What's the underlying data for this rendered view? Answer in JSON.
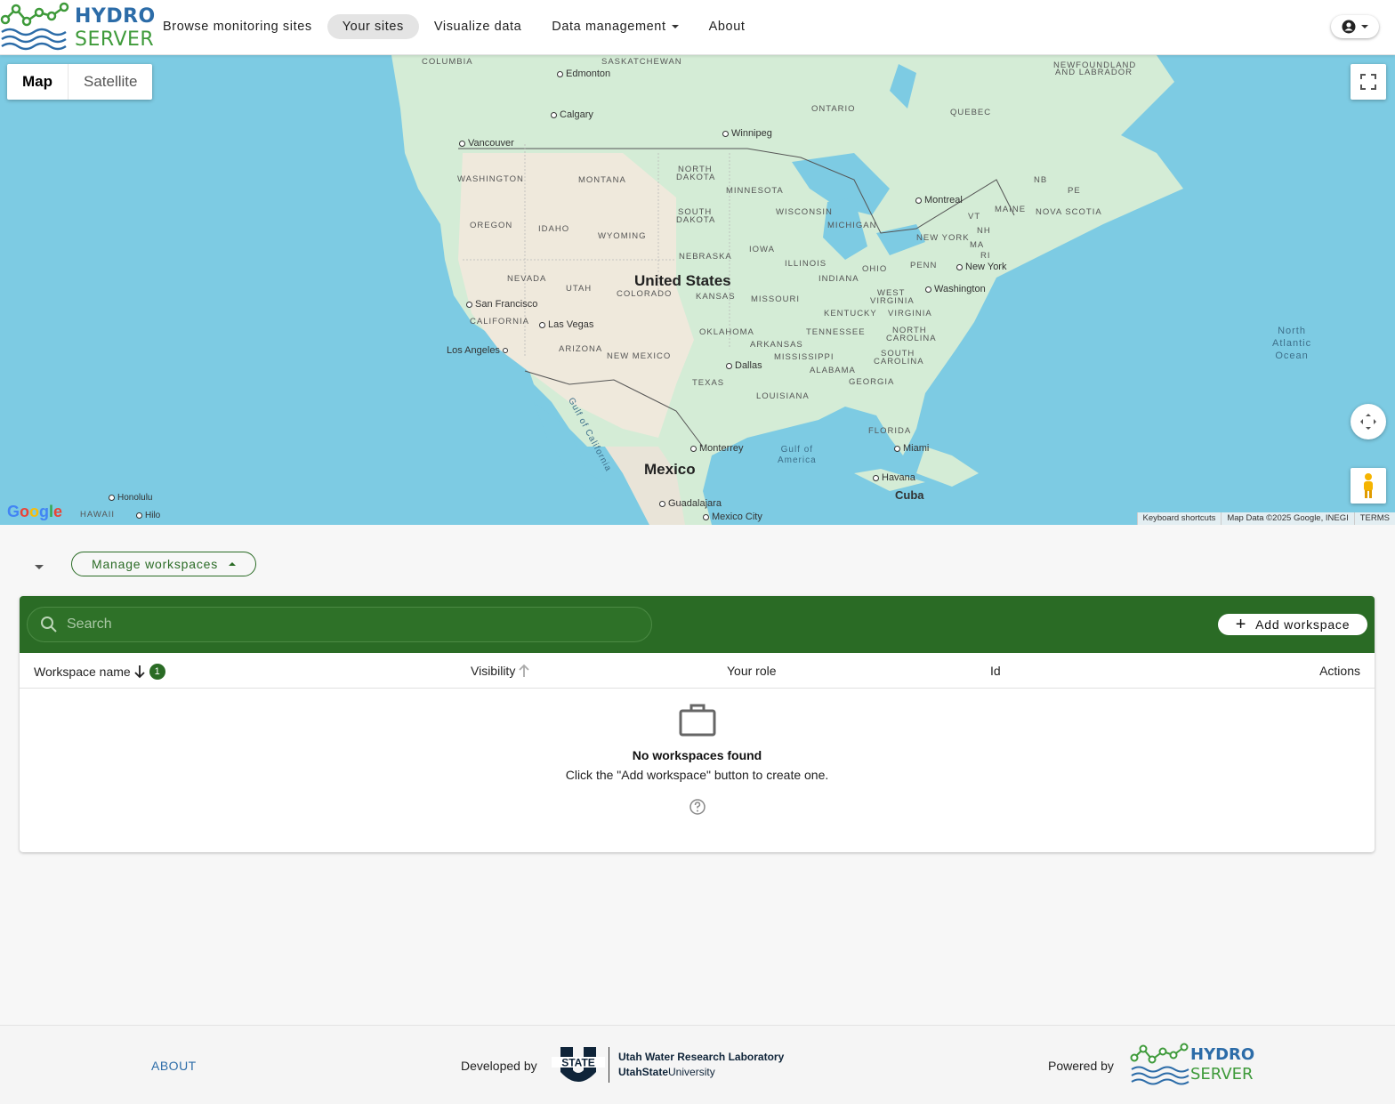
{
  "brand": {
    "line1": "HYDRO",
    "line2": "SERVER"
  },
  "nav": {
    "browse": "Browse monitoring sites",
    "your_sites": "Your sites",
    "visualize": "Visualize data",
    "data_management": "Data management",
    "about": "About"
  },
  "map": {
    "type_map": "Map",
    "type_satellite": "Satellite",
    "attribution": {
      "shortcuts": "Keyboard shortcuts",
      "data": "Map Data ©2025 Google, INEGI",
      "terms": "TERMS"
    },
    "google": "Google",
    "labels": {
      "saskatchewan": "SASKATCHEWAN",
      "columbia": "COLUMBIA",
      "newfoundland": "NEWFOUNDLAND",
      "labrador": "AND LABRADOR",
      "edmonton": "Edmonton",
      "calgary": "Calgary",
      "vancouver": "Vancouver",
      "winnipeg": "Winnipeg",
      "ontario": "ONTARIO",
      "quebec": "QUEBEC",
      "montreal": "Montreal",
      "nb": "NB",
      "pe": "PE",
      "maine": "MAINE",
      "nova_scotia": "NOVA SCOTIA",
      "vt": "VT",
      "nh": "NH",
      "ma": "MA",
      "ri": "RI",
      "washington": "WASHINGTON",
      "montana": "MONTANA",
      "north_dakota_1": "NORTH",
      "north_dakota_2": "DAKOTA",
      "minnesota": "MINNESOTA",
      "south_dakota_1": "SOUTH",
      "south_dakota_2": "DAKOTA",
      "wisconsin": "WISCONSIN",
      "michigan": "MICHIGAN",
      "new_york_state": "NEW YORK",
      "oregon": "OREGON",
      "idaho": "IDAHO",
      "wyoming": "WYOMING",
      "iowa": "IOWA",
      "nebraska": "NEBRASKA",
      "illinois": "ILLINOIS",
      "ohio": "OHIO",
      "penn": "PENN",
      "new_york": "New York",
      "nevada": "NEVADA",
      "utah": "UTAH",
      "united_states": "United States",
      "colorado": "COLORADO",
      "kansas": "KANSAS",
      "indiana": "INDIANA",
      "west_virginia_1": "WEST",
      "west_virginia_2": "VIRGINIA",
      "washington_dc": "Washington",
      "san_francisco": "San Francisco",
      "california": "CALIFORNIA",
      "missouri": "MISSOURI",
      "kentucky": "KENTUCKY",
      "virginia": "VIRGINIA",
      "las_vegas": "Las Vegas",
      "oklahoma": "OKLAHOMA",
      "tennessee": "TENNESSEE",
      "north_carolina_1": "NORTH",
      "north_carolina_2": "CAROLINA",
      "los_angeles": "Los Angeles",
      "arizona": "ARIZONA",
      "new_mexico": "NEW MEXICO",
      "arkansas": "ARKANSAS",
      "mississippi": "MISSISSIPPI",
      "south_carolina_1": "SOUTH",
      "south_carolina_2": "CAROLINA",
      "dallas": "Dallas",
      "alabama": "ALABAMA",
      "texas": "TEXAS",
      "louisiana": "LOUISIANA",
      "georgia": "GEORGIA",
      "north_atlantic_1": "North",
      "north_atlantic_2": "Atlantic",
      "north_atlantic_3": "Ocean",
      "florida": "FLORIDA",
      "miami": "Miami",
      "monterrey": "Monterrey",
      "gulf_america_1": "Gulf of",
      "gulf_america_2": "America",
      "gulf_california": "Gulf of California",
      "mexico": "Mexico",
      "havana": "Havana",
      "cuba": "Cuba",
      "guadalajara": "Guadalajara",
      "mexico_city": "Mexico City",
      "honolulu": "Honolulu",
      "hawaii": "HAWAII",
      "hilo": "Hilo"
    }
  },
  "workspaces": {
    "manage_label": "Manage workspaces",
    "search_placeholder": "Search",
    "add_label": "Add workspace",
    "columns": {
      "name": "Workspace name",
      "visibility": "Visibility",
      "role": "Your role",
      "id": "Id",
      "actions": "Actions"
    },
    "sort_badge": "1",
    "empty_title": "No workspaces found",
    "empty_sub": "Click the \"Add workspace\" button to create one."
  },
  "footer": {
    "about": "ABOUT",
    "developed_by": "Developed by",
    "lab_line1": "Utah Water Research Laboratory",
    "lab_line2_bold": "UtahState",
    "lab_line2": "University",
    "usu_mark": "STATE",
    "powered_by": "Powered by"
  },
  "colors": {
    "primary_green": "#2a6b25",
    "brand_blue": "#2c6ca8",
    "brand_green": "#3e9a3a",
    "water": "#7dcbe3",
    "land": "#d2ead4"
  },
  "icons": [
    "hydroserver-logo",
    "account-circle-icon",
    "fullscreen-icon",
    "camera-control-icon",
    "pegman-icon",
    "search-icon",
    "plus-icon",
    "arrow-down-icon",
    "arrow-up-icon",
    "briefcase-icon",
    "help-circle-icon",
    "usu-logo"
  ]
}
